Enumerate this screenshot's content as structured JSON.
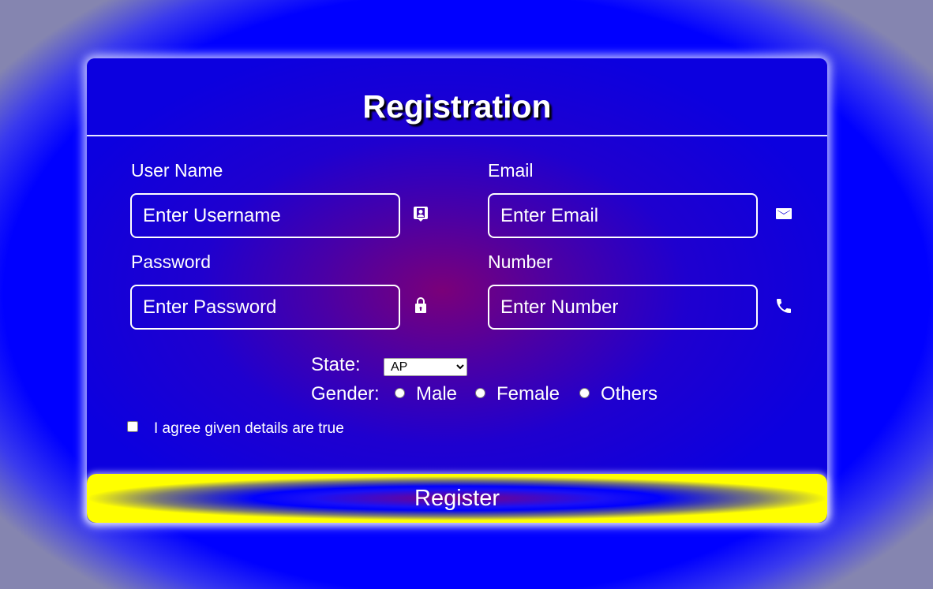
{
  "form": {
    "title": "Registration",
    "username": {
      "label": "User Name",
      "placeholder": "Enter Username",
      "icon": "contact-icon"
    },
    "email": {
      "label": "Email",
      "placeholder": "Enter Email",
      "icon": "mail-icon"
    },
    "password": {
      "label": "Password",
      "placeholder": "Enter Password",
      "icon": "lock-icon"
    },
    "number": {
      "label": "Number",
      "placeholder": "Enter Number",
      "icon": "phone-icon"
    },
    "state": {
      "label": "State:",
      "selected": "AP"
    },
    "gender": {
      "label": "Gender:",
      "options": [
        "Male",
        "Female",
        "Others"
      ]
    },
    "agree_text": "I agree given details are true",
    "register_label": "Register"
  },
  "colors": {
    "page_background": "#0000ff",
    "card_center": "#7a0079",
    "card_edge": "#0c00df",
    "button_edge": "#ffff00",
    "text": "#ffffff"
  }
}
